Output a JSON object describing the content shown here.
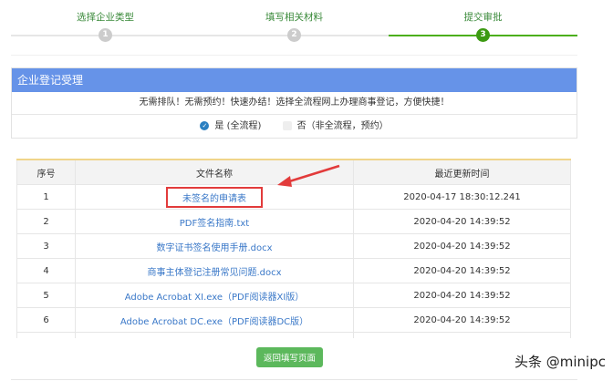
{
  "steps": [
    {
      "label": "选择企业类型",
      "num": "1"
    },
    {
      "label": "填写相关材料",
      "num": "2"
    },
    {
      "label": "提交审批",
      "num": "3"
    }
  ],
  "panel": {
    "title": "企业登记受理",
    "message": "无需排队！无需预约！快速办结！选择全流程网上办理商事登记，方便快捷！",
    "option_yes": "是 (全流程)",
    "option_no": "否（非全流程，预约）"
  },
  "table": {
    "headers": [
      "序号",
      "文件名称",
      "最近更新时间"
    ],
    "rows": [
      {
        "no": "1",
        "name": "未签名的申请表",
        "time": "2020-04-17 18:30:12.241"
      },
      {
        "no": "2",
        "name": "PDF签名指南.txt",
        "time": "2020-04-20 14:39:52"
      },
      {
        "no": "3",
        "name": "数字证书签名使用手册.docx",
        "time": "2020-04-20 14:39:52"
      },
      {
        "no": "4",
        "name": "商事主体登记注册常见问题.docx",
        "time": "2020-04-20 14:39:52"
      },
      {
        "no": "5",
        "name": "Adobe Acrobat XI.exe（PDF阅读器XI版）",
        "time": "2020-04-20 14:39:52"
      },
      {
        "no": "6",
        "name": "Adobe Acrobat DC.exe（PDF阅读器DC版）",
        "time": "2020-04-20 14:39:52"
      }
    ]
  },
  "back_button": "返回填写页面",
  "watermark": "头条 @minipc"
}
